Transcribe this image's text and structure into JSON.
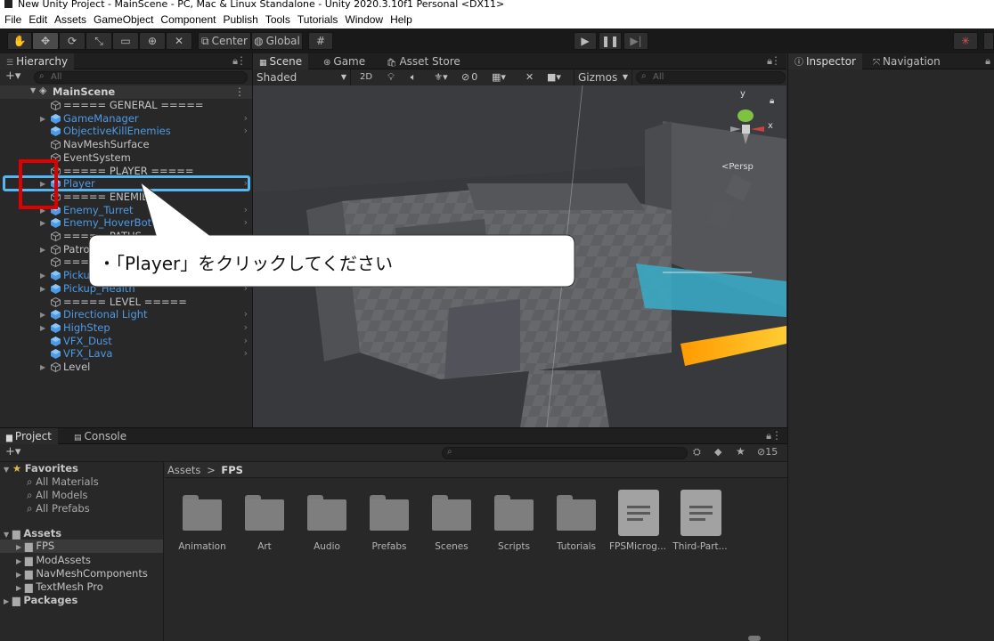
{
  "window": {
    "title": "New Unity Project - MainScene - PC, Mac & Linux Standalone - Unity 2020.3.10f1 Personal <DX11>"
  },
  "menu": [
    "File",
    "Edit",
    "Assets",
    "GameObject",
    "Component",
    "Publish",
    "Tools",
    "Tutorials",
    "Window",
    "Help"
  ],
  "toolbar": {
    "pivot_label": "Center",
    "space_label": "Global"
  },
  "hierarchy": {
    "tab": "Hierarchy",
    "search_placeholder": "All",
    "scene_name": "MainScene",
    "items": [
      {
        "label": "===== GENERAL =====",
        "prefab": false,
        "arrow": false,
        "chevron": false
      },
      {
        "label": "GameManager",
        "prefab": true,
        "arrow": true,
        "chevron": true
      },
      {
        "label": "ObjectiveKillEnemies",
        "prefab": true,
        "arrow": false,
        "chevron": true
      },
      {
        "label": "NavMeshSurface",
        "prefab": false,
        "arrow": false,
        "chevron": false
      },
      {
        "label": "EventSystem",
        "prefab": false,
        "arrow": false,
        "chevron": false
      },
      {
        "label": "===== PLAYER =====",
        "prefab": false,
        "arrow": false,
        "chevron": false
      },
      {
        "label": "Player",
        "prefab": true,
        "arrow": true,
        "chevron": true
      },
      {
        "label": "===== ENEMIES",
        "prefab": false,
        "arrow": false,
        "chevron": false
      },
      {
        "label": "Enemy_Turret",
        "prefab": true,
        "arrow": true,
        "chevron": true
      },
      {
        "label": "Enemy_HoverBot",
        "prefab": true,
        "arrow": true,
        "chevron": true
      },
      {
        "label": "===== PATHS",
        "prefab": false,
        "arrow": false,
        "chevron": false
      },
      {
        "label": "Patrol",
        "prefab": false,
        "arrow": true,
        "chevron": true
      },
      {
        "label": "=====",
        "prefab": false,
        "arrow": false,
        "chevron": false
      },
      {
        "label": "Pickup",
        "prefab": true,
        "arrow": true,
        "chevron": true
      },
      {
        "label": "Pickup_Health",
        "prefab": true,
        "arrow": true,
        "chevron": true
      },
      {
        "label": "===== LEVEL =====",
        "prefab": false,
        "arrow": false,
        "chevron": false
      },
      {
        "label": "Directional Light",
        "prefab": true,
        "arrow": true,
        "chevron": true
      },
      {
        "label": "HighStep",
        "prefab": true,
        "arrow": true,
        "chevron": true
      },
      {
        "label": "VFX_Dust",
        "prefab": true,
        "arrow": false,
        "chevron": true
      },
      {
        "label": "VFX_Lava",
        "prefab": true,
        "arrow": false,
        "chevron": true
      },
      {
        "label": "Level",
        "prefab": false,
        "arrow": true,
        "chevron": false
      }
    ]
  },
  "scene": {
    "tabs": [
      "Scene",
      "Game",
      "Asset Store"
    ],
    "shading": "Shaded",
    "mode_2d": "2D",
    "hidden_count": "0",
    "gizmos": "Gizmos",
    "search_placeholder": "All",
    "gizmo_x": "x",
    "gizmo_y": "y",
    "persp": "<Persp"
  },
  "inspector": {
    "tabs": [
      "Inspector",
      "Navigation"
    ]
  },
  "project": {
    "tabs": [
      "Project",
      "Console"
    ],
    "hidden_count": "15",
    "breadcrumb": "Assets > FPS",
    "breadcrumb_root": "Assets",
    "breadcrumb_sep": ">",
    "breadcrumb_current": "FPS",
    "favorites_label": "Favorites",
    "favorites": [
      "All Materials",
      "All Models",
      "All Prefabs"
    ],
    "assets_label": "Assets",
    "asset_folders": [
      "FPS",
      "ModAssets",
      "NavMeshComponents",
      "TextMesh Pro"
    ],
    "packages_label": "Packages",
    "grid_items": [
      {
        "label": "Animation",
        "kind": "folder"
      },
      {
        "label": "Art",
        "kind": "folder"
      },
      {
        "label": "Audio",
        "kind": "folder"
      },
      {
        "label": "Prefabs",
        "kind": "folder"
      },
      {
        "label": "Scenes",
        "kind": "folder"
      },
      {
        "label": "Scripts",
        "kind": "folder"
      },
      {
        "label": "Tutorials",
        "kind": "folder"
      },
      {
        "label": "FPSMicrog...",
        "kind": "document"
      },
      {
        "label": "Third-Part...",
        "kind": "document"
      }
    ]
  },
  "callout": {
    "text": "・「Player」をクリックしてください"
  },
  "colors": {
    "highlight_red": "#e00000",
    "highlight_blue": "#55b6f2",
    "prefab_blue": "#4d9be6"
  }
}
